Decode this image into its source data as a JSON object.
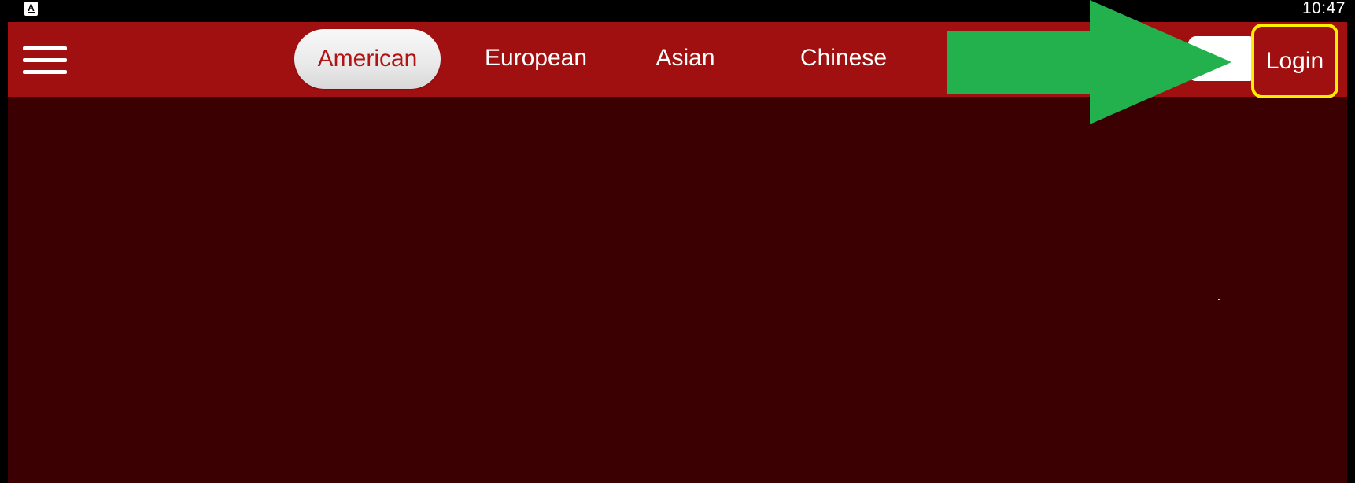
{
  "status_bar": {
    "time": "10:47",
    "app_icon_letter": "A"
  },
  "header": {
    "menu_icon": "hamburger-menu-icon",
    "tabs": [
      {
        "label": "American",
        "selected": true
      },
      {
        "label": "European",
        "selected": false
      },
      {
        "label": "Asian",
        "selected": false
      },
      {
        "label": "Chinese",
        "selected": false
      }
    ],
    "search_value": "",
    "login_label": "Login"
  },
  "annotations": {
    "arrow_color": "#22b14c",
    "highlight_color": "#ffee00"
  },
  "colors": {
    "header_bg": "#a11010",
    "content_bg": "#3b0001",
    "selected_tab_text": "#b01515"
  }
}
